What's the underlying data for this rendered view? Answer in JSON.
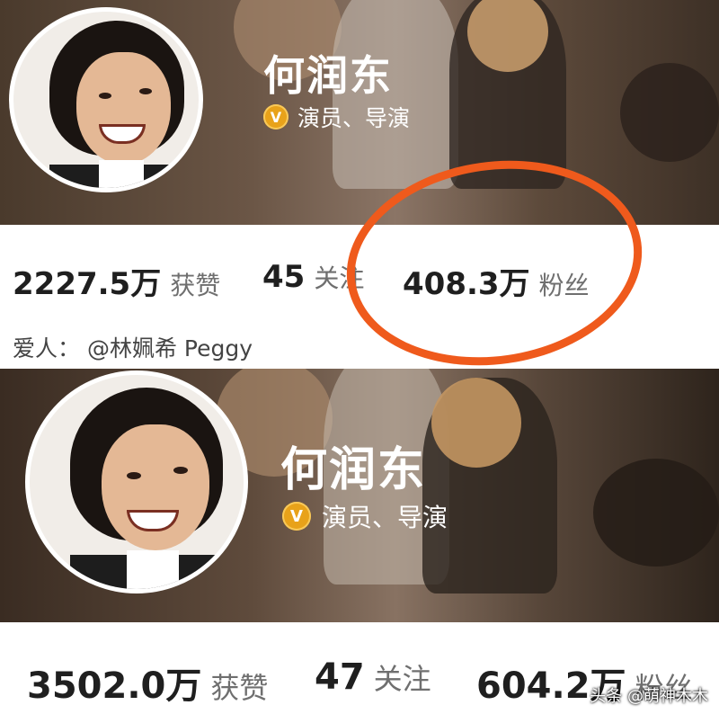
{
  "top": {
    "name": "何润东",
    "verified_badge": "V",
    "role": "演员、导演",
    "stats": {
      "likes_value": "2227.5万",
      "likes_label": "获赞",
      "following_value": "45",
      "following_label": "关注",
      "followers_value": "408.3万",
      "followers_label": "粉丝"
    },
    "spouse_prefix": "爱人：",
    "spouse_name": "@林姵希 Peggy"
  },
  "bottom": {
    "name": "何润东",
    "verified_badge": "V",
    "role": "演员、导演",
    "stats": {
      "likes_value": "3502.0万",
      "likes_label": "获赞",
      "following_value": "47",
      "following_label": "关注",
      "followers_value": "604.2万",
      "followers_label": "粉丝"
    }
  },
  "watermark": "头条 @萌神木木",
  "colors": {
    "highlight_ring": "#ef5a1c",
    "verified_badge": "#e8a21a",
    "banner_brown": "#5d4a3b"
  },
  "icons": [
    "verified-badge-icon"
  ]
}
